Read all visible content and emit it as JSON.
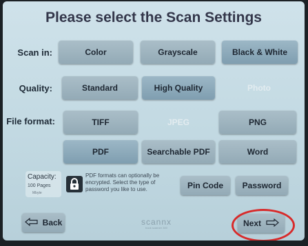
{
  "header": {
    "title": "Please select the Scan Settings"
  },
  "scan_in": {
    "label": "Scan in:",
    "options": [
      "Color",
      "Grayscale",
      "Black & White"
    ],
    "selected": "Black & White"
  },
  "quality": {
    "label": "Quality:",
    "options": [
      "Standard",
      "High Quality",
      "Photo"
    ],
    "selected": "High Quality",
    "disabled": [
      "Photo"
    ]
  },
  "file_format": {
    "label": "File format:",
    "options": [
      "TIFF",
      "JPEG",
      "PNG",
      "PDF",
      "Searchable PDF",
      "Word"
    ],
    "selected": "PDF",
    "disabled": [
      "JPEG"
    ]
  },
  "capacity": {
    "title": "Capacity:",
    "value": "100 Pages",
    "unit": "Mbyte"
  },
  "encryption": {
    "note": "PDF formats can optionally be encrypted. Select the type of password you like to use.",
    "options": [
      "Pin Code",
      "Password"
    ],
    "icon": "lock-icon"
  },
  "footer": {
    "back_label": "Back",
    "next_label": "Next",
    "logo_text": "scannx",
    "logo_tag": "book scanner 300",
    "highlight_color": "#d82a2a"
  }
}
